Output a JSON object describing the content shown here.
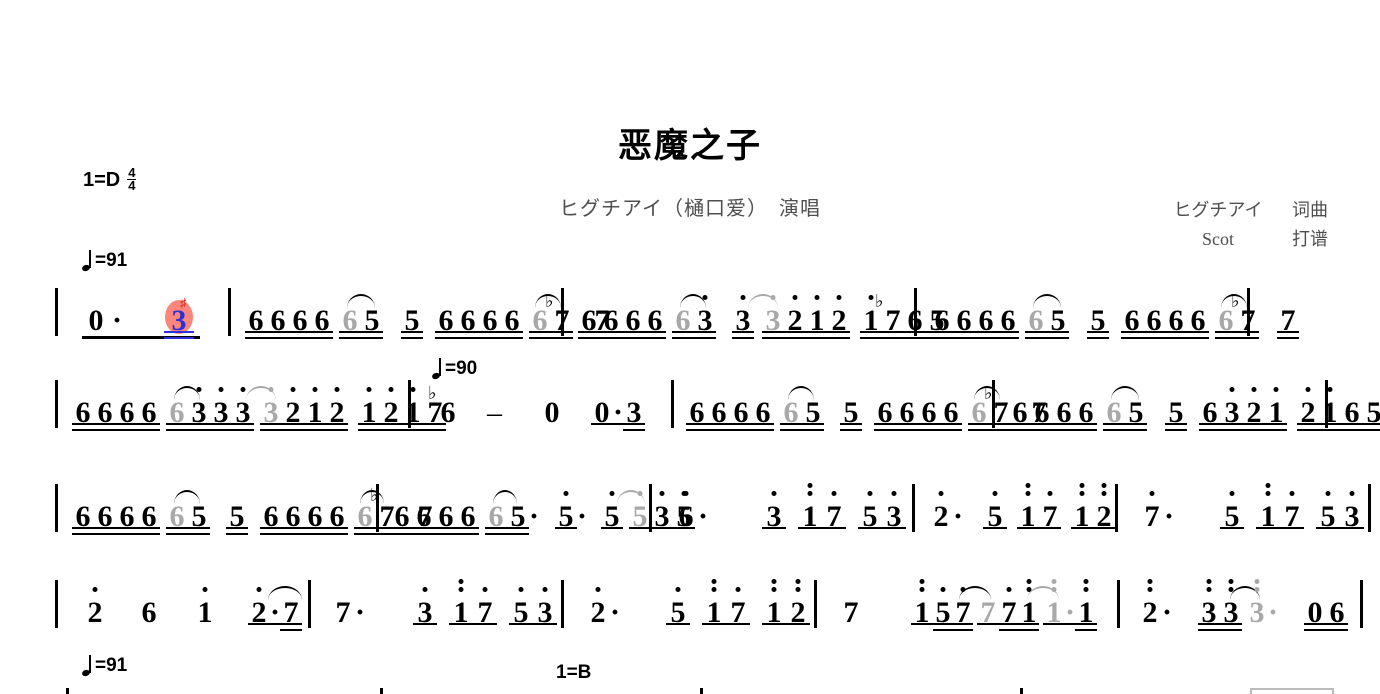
{
  "document": {
    "type": "numbered-musical-notation-jianpu",
    "title": "恶魔之子",
    "performer_line": "ヒグチアイ（樋口爱）　演唱",
    "credits": [
      {
        "name": "ヒグチアイ",
        "role": "词曲"
      },
      {
        "name": "Scot",
        "role": "打谱"
      }
    ],
    "key_signature": {
      "label": "1=D",
      "time_numerator": "4",
      "time_denominator": "4"
    },
    "tempo_marks": [
      {
        "value": "=91",
        "position": "line1-above-left"
      },
      {
        "value": "=90",
        "position": "line2-measure5"
      },
      {
        "value": "=91",
        "position": "line5-above-left"
      }
    ],
    "key_change": {
      "label": "1=B"
    },
    "colors": {
      "cursor_highlight": "#fb7a6e",
      "cursor_note": "#2f2ed8",
      "cursor_mark": "#e0372b",
      "tied_note_grey": "#a8a8a8",
      "ink": "#000000",
      "subtitle_grey": "#4f4f4f"
    }
  },
  "staves": [
    {
      "id": "line-1",
      "measures": [
        {
          "id": "m1",
          "notes": "0·   3",
          "active_note": "3"
        },
        {
          "id": "m2",
          "notes": "6666 65 5 6666 6♭7 7"
        },
        {
          "id": "m3",
          "notes": "6666 63̇ 3̇ 3̇2̇1̇2̇ 1̇♭765"
        },
        {
          "id": "m4",
          "notes": "6666 65 5 6666 6♭7 7"
        }
      ]
    },
    {
      "id": "line-2",
      "measures": [
        {
          "id": "m5",
          "notes": "6666 63̇3̇3̇ 3̇2̇1̇2̇ 1̇2̇1̇♭7"
        },
        {
          "id": "m6",
          "notes": "6 - 0 0·3"
        },
        {
          "id": "m7",
          "notes": "6666 65 5 6666 6♭7 7"
        },
        {
          "id": "m8",
          "notes": "6666 65 5 63̇2̇1̇ 2̇1̇65"
        }
      ]
    },
    {
      "id": "line-3",
      "measures": [
        {
          "id": "m9",
          "notes": "6666 65 5 6666 6♭7 7"
        },
        {
          "id": "m10",
          "notes": "6666 65· 5̇· 5 5̇3̇5"
        },
        {
          "id": "m11",
          "notes": "6̇·  3̇ 1̈7̇ 5̇3̇"
        },
        {
          "id": "m12",
          "notes": "2̇· 5̇1̈7̇1̈2̈"
        },
        {
          "id": "m13",
          "notes": "7̇·  5̇ 1̈7̇ 5̇3̇"
        }
      ]
    },
    {
      "id": "line-4",
      "measures": [
        {
          "id": "m14",
          "notes": "2̇ 6 1̇ 2̇·7"
        },
        {
          "id": "m15",
          "notes": "7·  3̇ 1̈7̇ 5̇3̇"
        },
        {
          "id": "m16",
          "notes": "2̇·  5̇ 1̈7̇ 1̈2̈"
        },
        {
          "id": "m17",
          "notes": "7 1̈ 5̇7̇ 7 7̇1̈ 1̈· 1̈"
        },
        {
          "id": "m18",
          "notes": "2̈· 3̈3̈ 3̈· 06"
        }
      ]
    }
  ],
  "glyph_legend": {
    "dot_above": "octave up",
    "double_dot_above": "two octaves up",
    "underline": "eighth-note beam",
    "double_underline": "sixteenth-note beam",
    "dash": "hold / extend beat",
    "flat_sign": "♭",
    "arc": "tie or slur",
    "zero": "rest"
  }
}
